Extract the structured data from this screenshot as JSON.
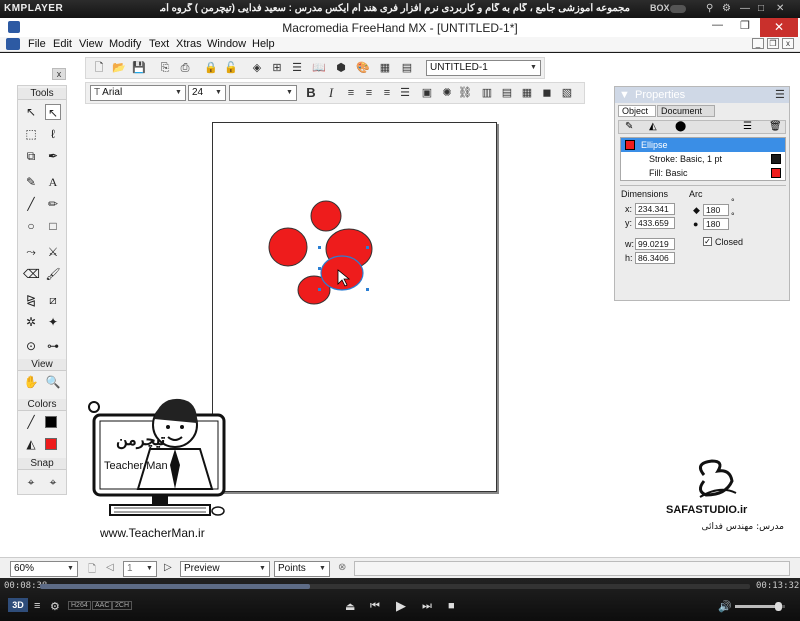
{
  "player": {
    "name": "KMPLAYER",
    "title": "مجموعه آموزشی جامع ، گام به گام و کاربردی نرم افزار فری هند ام ایکس   مدرس : سعید فدایی (تیچرمن ) گروه آموزشی پادشاه گرافیست ها",
    "box_label": "BOX",
    "time_elapsed": "00:08:38",
    "time_total": "00:13:32",
    "progress": 0.38,
    "codec_tags": [
      "H264",
      "AAC",
      "2CH"
    ],
    "mode_3d": "3D"
  },
  "app": {
    "title": "Macromedia FreeHand MX - [UNTITLED-1*]",
    "menus": [
      {
        "label": "File"
      },
      {
        "label": "Edit"
      },
      {
        "label": "View"
      },
      {
        "label": "Modify"
      },
      {
        "label": "Text"
      },
      {
        "label": "Xtras"
      },
      {
        "label": "Window"
      },
      {
        "label": "Help"
      }
    ]
  },
  "toolbar": {
    "document_select": "UNTITLED-1",
    "font_name": "Arial",
    "font_size": "24",
    "font_style": "",
    "bold": "B",
    "italic": "I"
  },
  "tools_panel": {
    "header": "Tools",
    "view_header": "View",
    "colors_header": "Colors",
    "snap_header": "Snap",
    "close_glyph": "x"
  },
  "properties": {
    "title": "Properties",
    "tabs": [
      "Object",
      "Document"
    ],
    "items": [
      {
        "label": "Ellipse",
        "selected": true
      },
      {
        "label": "Stroke: Basic, 1 pt",
        "swatch": "#1a1a1a"
      },
      {
        "label": "Fill: Basic",
        "swatch": "#ee1c1c"
      }
    ],
    "dimensions_label": "Dimensions",
    "arc_label": "Arc",
    "x_label": "x:",
    "x": "234.341",
    "y_label": "y:",
    "y": "433.659",
    "w_label": "w:",
    "w": "99.0219",
    "h_label": "h:",
    "h": "86.3406",
    "arc_start": "180",
    "arc_end": "180",
    "closed_label": "Closed"
  },
  "status": {
    "zoom": "60%",
    "page_number": "1",
    "view_mode": "Preview",
    "units": "Points"
  },
  "watermark": {
    "teacherman_site": "www.TeacherMan.ir",
    "teacherman_name": "Teacher Man",
    "teacherman_fa": "تیچرمن",
    "safa_site": "SAFASTUDIO.ir",
    "safa_teacher": "مدرس: مهندس فدائی"
  },
  "colors": {
    "ellipse_fill": "#ee1c1c",
    "selection_handle": "#2a7fd4",
    "selection_row": "#3a8ee6"
  }
}
